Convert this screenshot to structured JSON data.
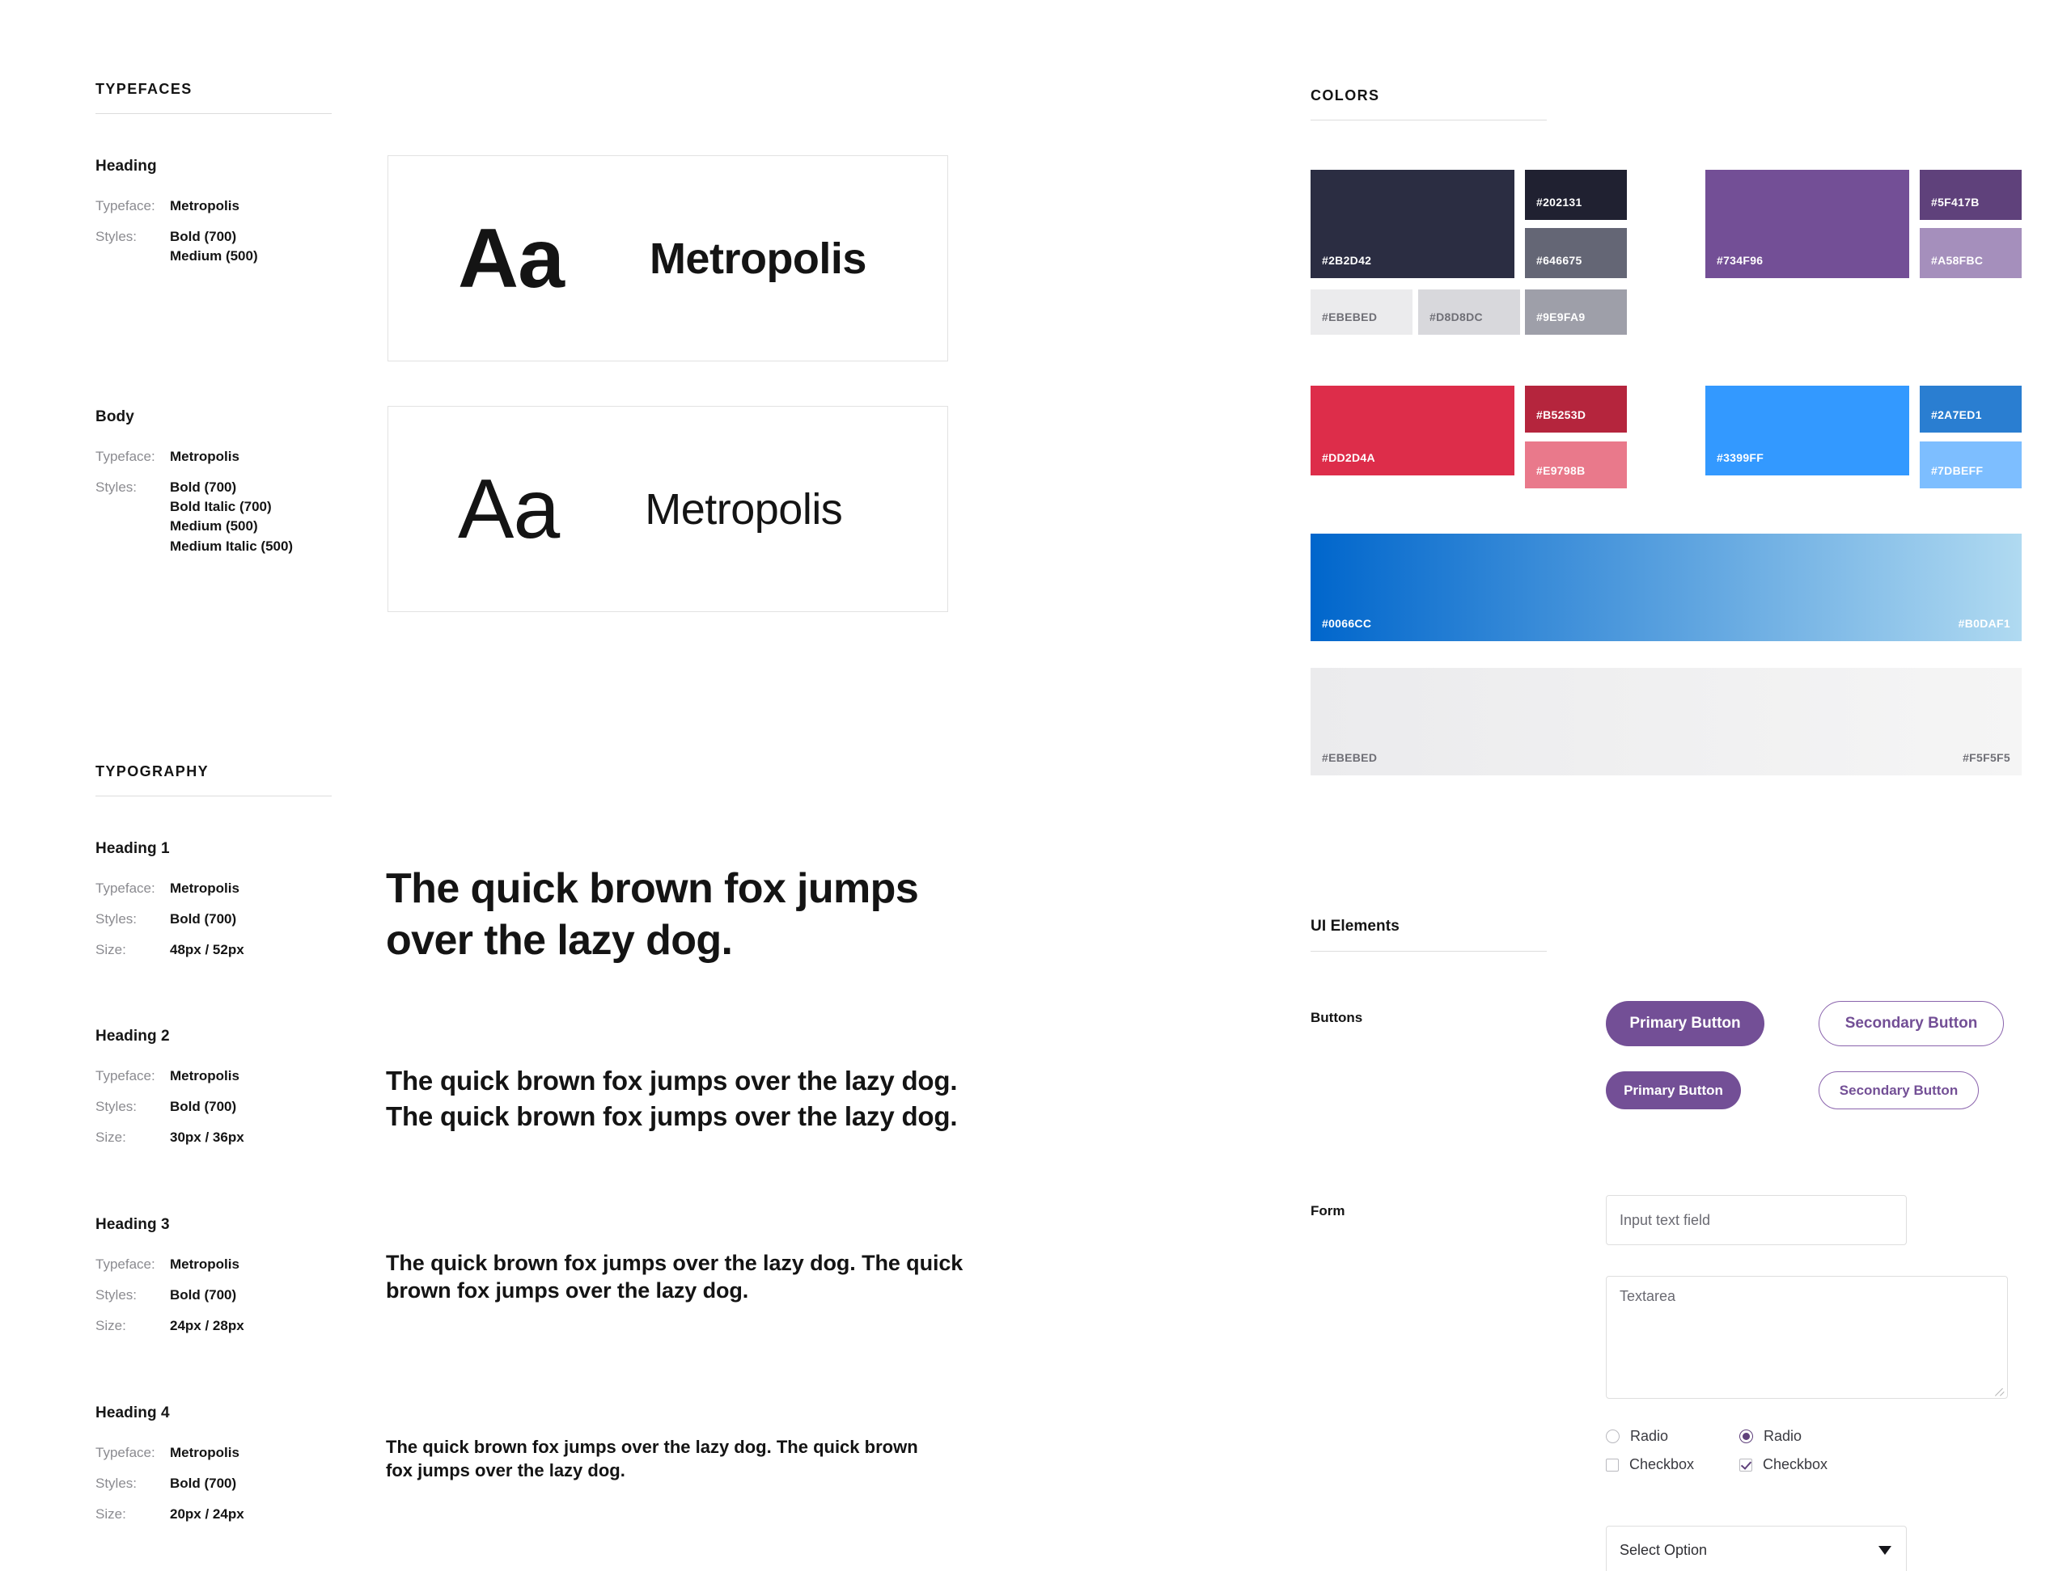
{
  "sections": {
    "typefaces": "TYPEFACES",
    "typography": "TYPOGRAPHY",
    "colors": "COLORS",
    "ui_elements": "UI Elements"
  },
  "typefaces": [
    {
      "title": "Heading",
      "rows": [
        {
          "key": "Typeface:",
          "values": [
            "Metropolis"
          ]
        },
        {
          "key": "Styles:",
          "values": [
            "Bold (700)",
            "Medium (500)"
          ]
        }
      ],
      "specimen": {
        "aa": "Aa",
        "name": "Metropolis",
        "weight": "bold"
      }
    },
    {
      "title": "Body",
      "rows": [
        {
          "key": "Typeface:",
          "values": [
            "Metropolis"
          ]
        },
        {
          "key": "Styles:",
          "values": [
            "Bold (700)",
            "Bold Italic (700)",
            "Medium (500)",
            "Medium Italic (500)"
          ]
        }
      ],
      "specimen": {
        "aa": "Aa",
        "name": "Metropolis",
        "weight": "light"
      }
    }
  ],
  "typography": [
    {
      "title": "Heading 1",
      "rows": [
        {
          "key": "Typeface:",
          "values": [
            "Metropolis"
          ]
        },
        {
          "key": "Styles:",
          "values": [
            "Bold (700)"
          ]
        },
        {
          "key": "Size:",
          "values": [
            "48px / 52px"
          ]
        }
      ],
      "sample": "The quick brown fox jumps over the lazy dog."
    },
    {
      "title": "Heading 2",
      "rows": [
        {
          "key": "Typeface:",
          "values": [
            "Metropolis"
          ]
        },
        {
          "key": "Styles:",
          "values": [
            "Bold (700)"
          ]
        },
        {
          "key": "Size:",
          "values": [
            "30px / 36px"
          ]
        }
      ],
      "sample": "The quick brown fox jumps over the lazy dog. The quick brown fox jumps over the lazy dog."
    },
    {
      "title": "Heading 3",
      "rows": [
        {
          "key": "Typeface:",
          "values": [
            "Metropolis"
          ]
        },
        {
          "key": "Styles:",
          "values": [
            "Bold (700)"
          ]
        },
        {
          "key": "Size:",
          "values": [
            "24px / 28px"
          ]
        }
      ],
      "sample": "The quick brown fox jumps over the lazy dog. The quick brown fox jumps over the lazy dog."
    },
    {
      "title": "Heading 4",
      "rows": [
        {
          "key": "Typeface:",
          "values": [
            "Metropolis"
          ]
        },
        {
          "key": "Styles:",
          "values": [
            "Bold (700)"
          ]
        },
        {
          "key": "Size:",
          "values": [
            "20px / 24px"
          ]
        }
      ],
      "sample": "The quick brown fox jumps over the lazy dog. The quick brown fox jumps over the lazy dog."
    }
  ],
  "colors": {
    "groups": [
      {
        "name": "neutral-dark",
        "large": {
          "hex": "#2B2D42",
          "text_color": "#FFFFFF"
        },
        "small": [
          {
            "hex": "#202131",
            "text_color": "#FFFFFF"
          },
          {
            "hex": "#646675",
            "text_color": "#FFFFFF"
          }
        ]
      },
      {
        "name": "purple",
        "large": {
          "hex": "#734F96",
          "text_color": "#FFFFFF"
        },
        "small": [
          {
            "hex": "#5F417B",
            "text_color": "#FFFFFF"
          },
          {
            "hex": "#A58FBC",
            "text_color": "#FFFFFF"
          }
        ]
      },
      {
        "name": "red",
        "large": {
          "hex": "#DD2D4A",
          "text_color": "#FFFFFF"
        },
        "small": [
          {
            "hex": "#B5253D",
            "text_color": "#FFFFFF"
          },
          {
            "hex": "#E9798B",
            "text_color": "#FFFFFF"
          }
        ]
      },
      {
        "name": "blue",
        "large": {
          "hex": "#3399FF",
          "text_color": "#FFFFFF"
        },
        "small": [
          {
            "hex": "#2A7ED1",
            "text_color": "#FFFFFF"
          },
          {
            "hex": "#7DBEFF",
            "text_color": "#FFFFFF"
          }
        ]
      }
    ],
    "greys": [
      {
        "hex": "#EBEBED",
        "text_color": "#6F6F76"
      },
      {
        "hex": "#D8D8DC",
        "text_color": "#6F6F76"
      },
      {
        "hex": "#9E9FA9",
        "text_color": "#FFFFFF"
      }
    ],
    "gradients": [
      {
        "from": "#0066CC",
        "to": "#B0DAF1",
        "from_text_color": "#FFFFFF",
        "to_text_color": "#FFFFFF"
      },
      {
        "from": "#EBEBED",
        "to": "#F5F5F5",
        "from_text_color": "#6F6F76",
        "to_text_color": "#6F6F76"
      }
    ]
  },
  "ui": {
    "buttons_label": "Buttons",
    "form_label": "Form",
    "buttons": [
      {
        "text": "Primary Button",
        "variant": "primary",
        "size": "large"
      },
      {
        "text": "Secondary Button",
        "variant": "secondary",
        "size": "large"
      },
      {
        "text": "Primary Button",
        "variant": "primary",
        "size": "small"
      },
      {
        "text": "Secondary Button",
        "variant": "secondary",
        "size": "small"
      }
    ],
    "input_placeholder": "Input text field",
    "textarea_placeholder": "Textarea",
    "radios": [
      {
        "label": "Radio",
        "checked": false
      },
      {
        "label": "Radio",
        "checked": true
      }
    ],
    "checkboxes": [
      {
        "label": "Checkbox",
        "checked": false
      },
      {
        "label": "Checkbox",
        "checked": true
      }
    ],
    "select_value": "Select Option"
  }
}
